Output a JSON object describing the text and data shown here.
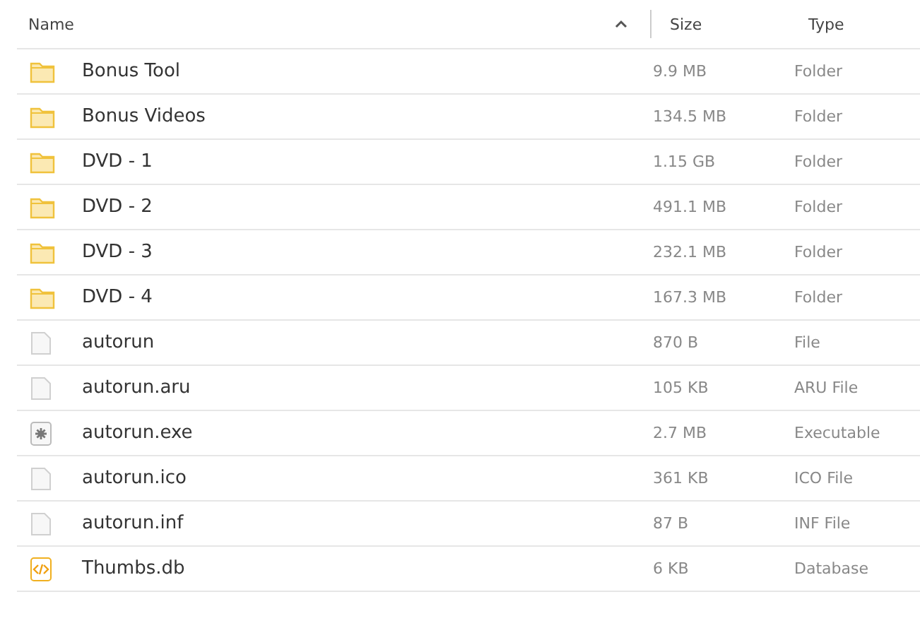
{
  "columns": [
    {
      "label": "Name",
      "sorted": true
    },
    {
      "label": "Size",
      "sorted": false
    },
    {
      "label": "Type",
      "sorted": false
    }
  ],
  "rows": [
    {
      "kind": "folder",
      "name": "Bonus Tool",
      "size": "9.9 MB",
      "type": "Folder"
    },
    {
      "kind": "folder",
      "name": "Bonus Videos",
      "size": "134.5 MB",
      "type": "Folder"
    },
    {
      "kind": "folder",
      "name": "DVD - 1",
      "size": "1.15 GB",
      "type": "Folder"
    },
    {
      "kind": "folder",
      "name": "DVD - 2",
      "size": "491.1 MB",
      "type": "Folder"
    },
    {
      "kind": "folder",
      "name": "DVD - 3",
      "size": "232.1 MB",
      "type": "Folder"
    },
    {
      "kind": "folder",
      "name": "DVD - 4",
      "size": "167.3 MB",
      "type": "Folder"
    },
    {
      "kind": "file",
      "name": "autorun",
      "size": "870 B",
      "type": "File"
    },
    {
      "kind": "file",
      "name": "autorun.aru",
      "size": "105 KB",
      "type": "ARU File"
    },
    {
      "kind": "executable",
      "name": "autorun.exe",
      "size": "2.7 MB",
      "type": "Executable"
    },
    {
      "kind": "file",
      "name": "autorun.ico",
      "size": "361 KB",
      "type": "ICO File"
    },
    {
      "kind": "file",
      "name": "autorun.inf",
      "size": "87 B",
      "type": "INF File"
    },
    {
      "kind": "code",
      "name": "Thumbs.db",
      "size": "6 KB",
      "type": "Database"
    }
  ]
}
